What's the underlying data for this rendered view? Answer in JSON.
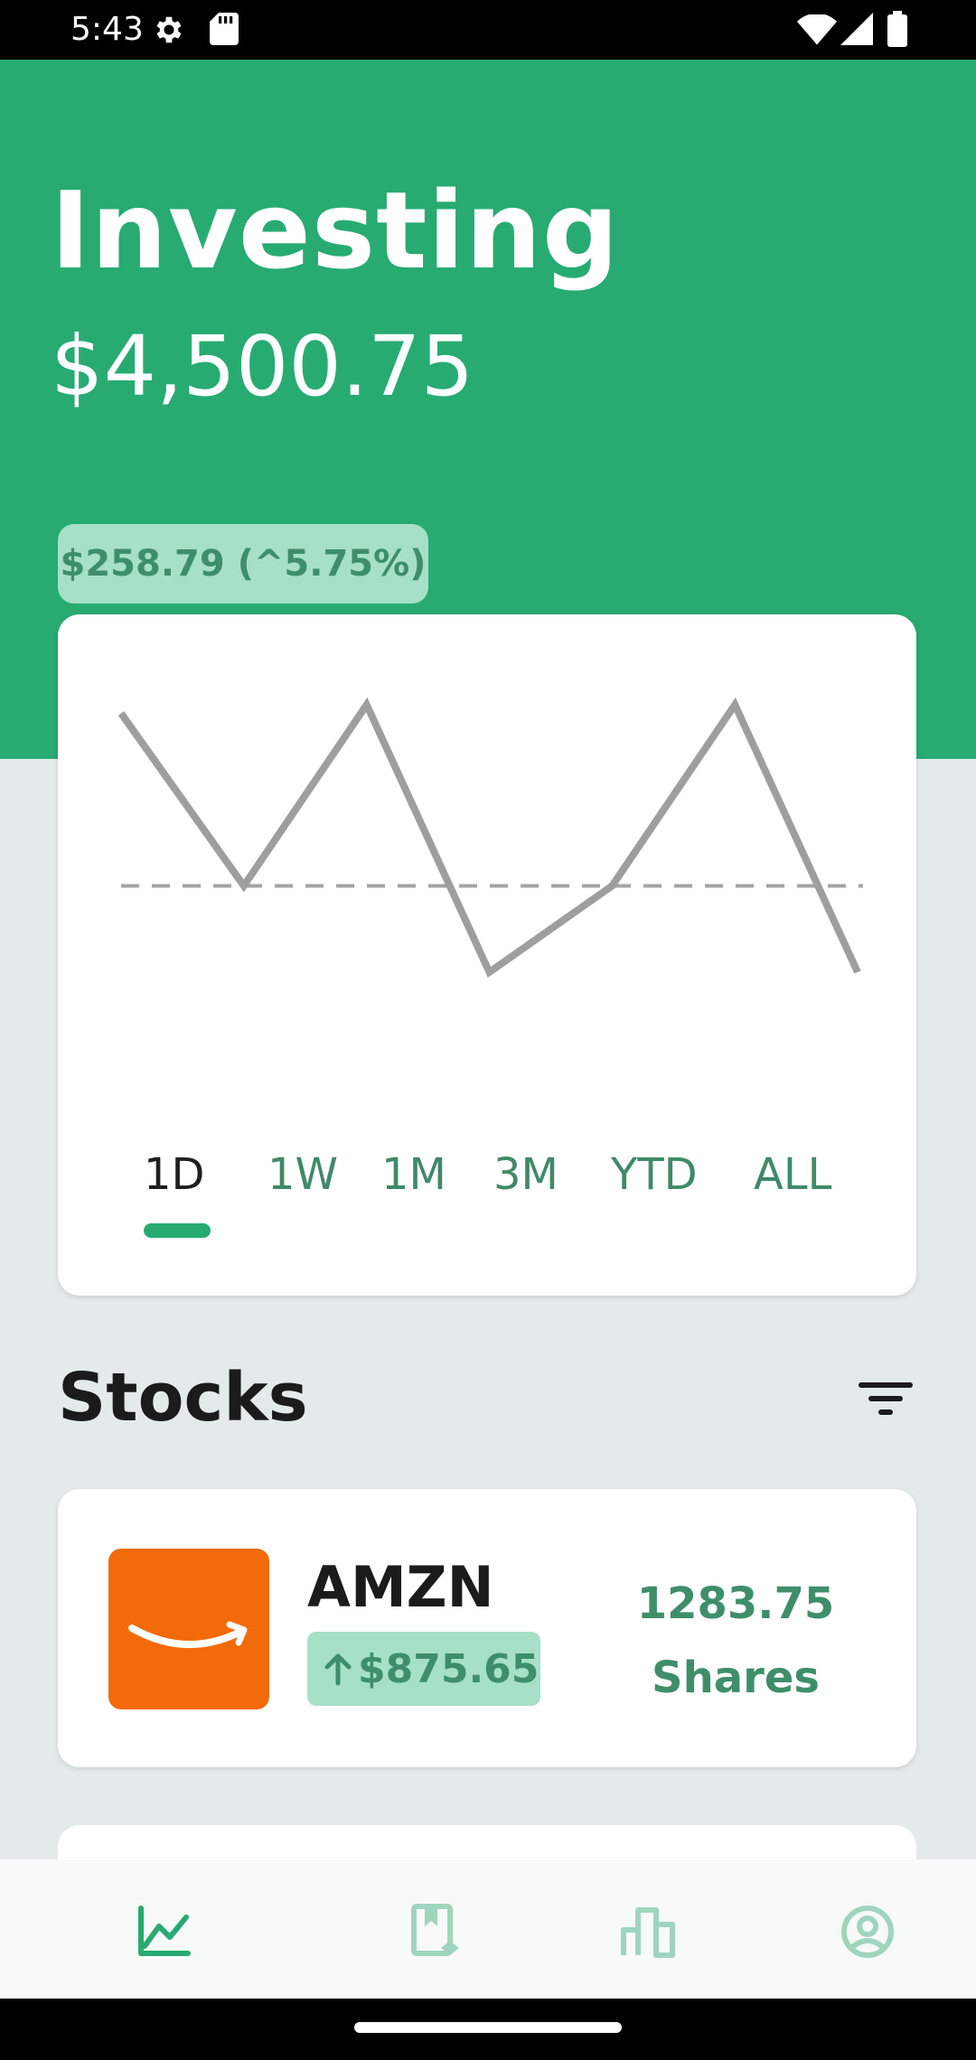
{
  "status_bar": {
    "time": "5:43",
    "icons": [
      "settings-icon",
      "sd-card-icon",
      "wifi-icon",
      "signal-icon",
      "battery-icon"
    ]
  },
  "header": {
    "title": "Investing",
    "balance": "$4,500.75",
    "change": "$258.79 (^5.75%)"
  },
  "chart": {
    "series_values": [
      3.2,
      1.2,
      3.3,
      0.2,
      1.2,
      3.3,
      0.2
    ],
    "baseline": 1.2,
    "ranges": [
      "1D",
      "1W",
      "1M",
      "3M",
      "YTD",
      "ALL"
    ],
    "selected_range": "1D"
  },
  "stocks": {
    "title": "Stocks",
    "items": [
      {
        "ticker": "AMZN",
        "gain": "$875.65",
        "shares_value": "1283.75",
        "shares_label": "Shares",
        "logo": "amazon-logo"
      }
    ]
  },
  "bottom_nav": {
    "items": [
      "chart-line-icon",
      "bookmark-stack-icon",
      "bar-chart-icon",
      "account-circle-icon"
    ],
    "active": "chart-line-icon"
  },
  "colors": {
    "brand_green": "#27ab72",
    "chip_green": "#a6e0c6",
    "text_green": "#3e8e6b",
    "amazon_orange": "#f36a0b",
    "chart_line": "#9e9e9e"
  }
}
